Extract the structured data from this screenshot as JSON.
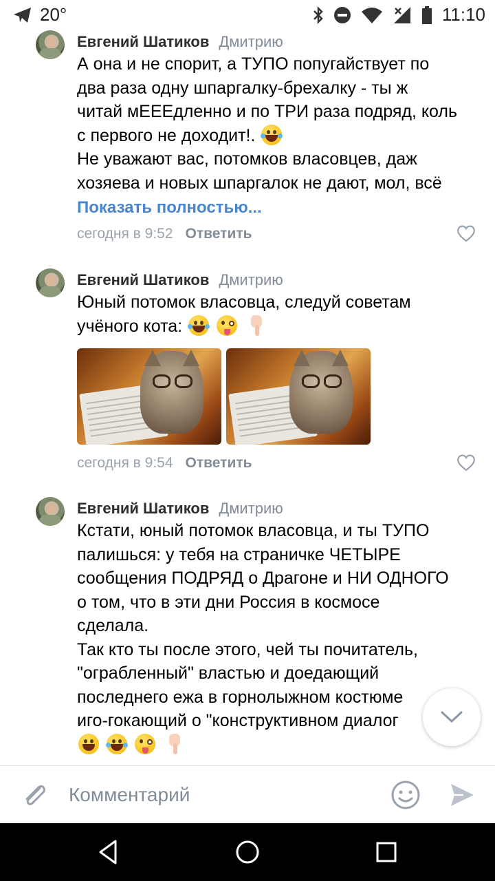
{
  "status_bar": {
    "temperature": "20°",
    "time": "11:10"
  },
  "comments": [
    {
      "author": "Евгений Шатиков",
      "reply_to": "Дмитрию",
      "lines": [
        "А она и не спорит, а ТУПО попугайствует по",
        "два раза одну шпаргалку-брехалку - ты ж",
        "читай мЕЕЕдленно и по ТРИ раза подряд, коль",
        "с первого не доходит!.",
        "Не уважают вас, потомков власовцев, даж",
        "хозяева и новых шпаргалок не дают, мол, всё"
      ],
      "show_more": "Показать полностью...",
      "time": "сегодня в 9:52",
      "reply_label": "Ответить"
    },
    {
      "author": "Евгений Шатиков",
      "reply_to": "Дмитрию",
      "lines": [
        "Юный потомок власовца, следуй советам",
        "учёного кота:"
      ],
      "time": "сегодня в 9:54",
      "reply_label": "Ответить"
    },
    {
      "author": "Евгений Шатиков",
      "reply_to": "Дмитрию",
      "lines": [
        "Кстати, юный потомок власовца, и ты ТУПО",
        "палишься: у тебя на страничке ЧЕТЫРЕ",
        "сообщения ПОДРЯД о Драгоне и НИ ОДНОГО",
        "о том, что в эти дни Россия в космосе",
        "сделала.",
        "Так кто ты после этого, чей ты почитатель,",
        "\"ограбленный\" властью и доедающий",
        "последнего ежа в горнолыжном костюме",
        "иго-гокающий о \"конструктивном диалог"
      ]
    }
  ],
  "composer": {
    "placeholder": "Комментарий"
  },
  "colors": {
    "link": "#4986cc",
    "muted": "#99a2ad",
    "author": "#2c2d2e"
  },
  "icons": [
    "telegram-icon",
    "bluetooth-icon",
    "dnd-icon",
    "wifi-icon",
    "signal-icon",
    "battery-icon",
    "like-icon",
    "chevron-down-icon",
    "attach-icon",
    "smile-icon",
    "send-icon",
    "back-icon",
    "home-icon",
    "recents-icon"
  ]
}
